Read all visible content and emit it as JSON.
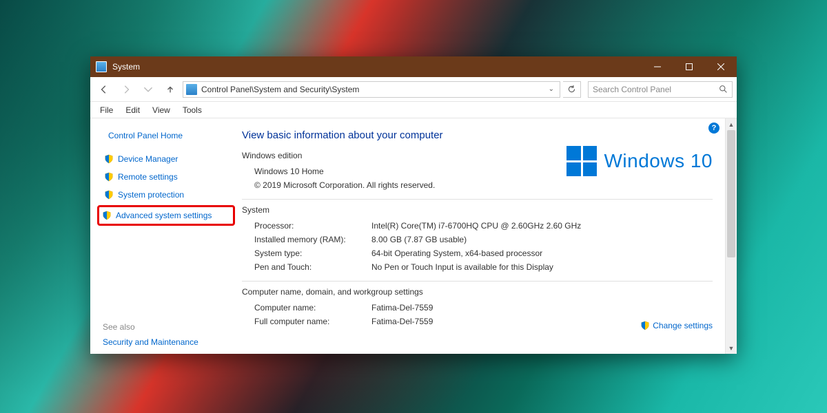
{
  "titlebar": {
    "title": "System"
  },
  "nav": {
    "path": "Control Panel\\System and Security\\System",
    "search_placeholder": "Search Control Panel"
  },
  "menubar": [
    "File",
    "Edit",
    "View",
    "Tools"
  ],
  "sidebar": {
    "home": "Control Panel Home",
    "items": [
      {
        "label": "Device Manager"
      },
      {
        "label": "Remote settings"
      },
      {
        "label": "System protection"
      },
      {
        "label": "Advanced system settings"
      }
    ],
    "see_also_label": "See also",
    "see_also_items": [
      "Security and Maintenance"
    ]
  },
  "content": {
    "heading": "View basic information about your computer",
    "edition_label": "Windows edition",
    "edition_name": "Windows 10 Home",
    "copyright": "© 2019 Microsoft Corporation. All rights reserved.",
    "brand": "Windows 10",
    "system_label": "System",
    "rows": [
      {
        "k": "Processor:",
        "v": "Intel(R) Core(TM) i7-6700HQ CPU @ 2.60GHz   2.60 GHz"
      },
      {
        "k": "Installed memory (RAM):",
        "v": "8.00 GB (7.87 GB usable)"
      },
      {
        "k": "System type:",
        "v": "64-bit Operating System, x64-based processor"
      },
      {
        "k": "Pen and Touch:",
        "v": "No Pen or Touch Input is available for this Display"
      }
    ],
    "cndw_label": "Computer name, domain, and workgroup settings",
    "cndw_rows": [
      {
        "k": "Computer name:",
        "v": "Fatima-Del-7559"
      },
      {
        "k": "Full computer name:",
        "v": "Fatima-Del-7559"
      }
    ],
    "change_settings": "Change settings"
  }
}
